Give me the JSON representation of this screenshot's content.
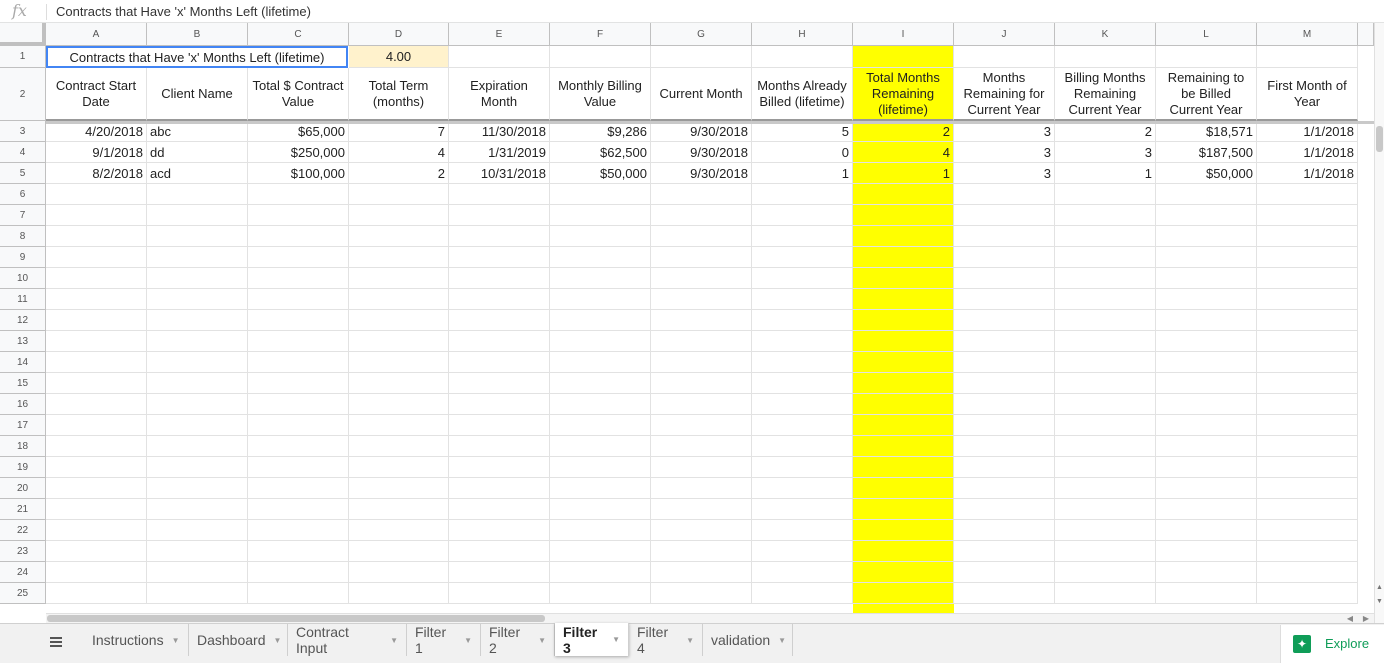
{
  "formula_bar": {
    "fx": "fx",
    "text": "Contracts that Have 'x' Months Left (lifetime)"
  },
  "columns": [
    "A",
    "B",
    "C",
    "D",
    "E",
    "F",
    "G",
    "H",
    "I",
    "J",
    "K",
    "L",
    "M"
  ],
  "rows": [
    "1",
    "2",
    "3",
    "4",
    "5",
    "6",
    "7",
    "8",
    "9",
    "10",
    "11",
    "12",
    "13",
    "14",
    "15",
    "16",
    "17",
    "18",
    "19",
    "20",
    "21",
    "22",
    "23",
    "24",
    "25"
  ],
  "row1": {
    "title": "Contracts that Have 'x' Months Left (lifetime)",
    "value": "4.00"
  },
  "headers": [
    "Contract Start Date",
    "Client Name",
    "Total $ Contract Value",
    "Total Term (months)",
    "Expiration Month",
    "Monthly Billing Value",
    "Current Month",
    "Months Already Billed (lifetime)",
    "Total Months Remaining (lifetime)",
    "Months Remaining for Current Year",
    "Billing Months Remaining Current Year",
    "Remaining to be Billed Current Year",
    "First Month of Year"
  ],
  "data_rows": [
    [
      "4/20/2018",
      "abc",
      "$65,000",
      "7",
      "11/30/2018",
      "$9,286",
      "9/30/2018",
      "5",
      "2",
      "3",
      "2",
      "$18,571",
      "1/1/2018"
    ],
    [
      "9/1/2018",
      "dd",
      "$250,000",
      "4",
      "1/31/2019",
      "$62,500",
      "9/30/2018",
      "0",
      "4",
      "3",
      "3",
      "$187,500",
      "1/1/2018"
    ],
    [
      "8/2/2018",
      "acd",
      "$100,000",
      "2",
      "10/31/2018",
      "$50,000",
      "9/30/2018",
      "1",
      "1",
      "3",
      "1",
      "$50,000",
      "1/1/2018"
    ]
  ],
  "tabs": [
    {
      "label": "Instructions",
      "active": false
    },
    {
      "label": "Dashboard",
      "active": false
    },
    {
      "label": "Contract Input",
      "active": false
    },
    {
      "label": "Filter 1",
      "active": false
    },
    {
      "label": "Filter 2",
      "active": false
    },
    {
      "label": "Filter 3",
      "active": true
    },
    {
      "label": "Filter 4",
      "active": false
    },
    {
      "label": "validation",
      "active": false
    }
  ],
  "explore": {
    "label": "Explore",
    "icon": "explore-icon"
  },
  "colors": {
    "highlight": "#ffff00",
    "active_cell_border": "#4285f4",
    "d1_fill": "#fff2cc",
    "explore_green": "#0f9d58"
  }
}
